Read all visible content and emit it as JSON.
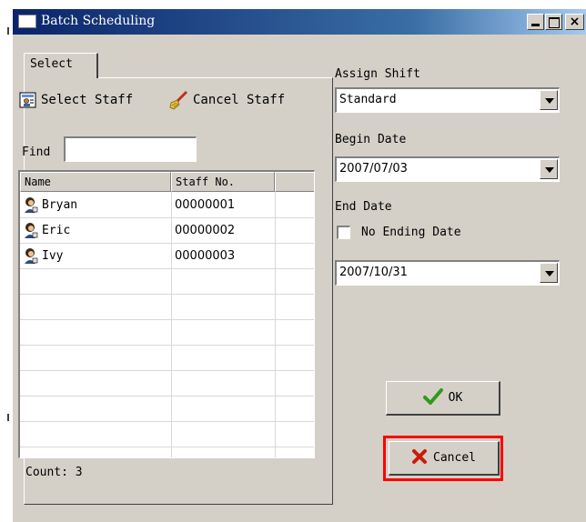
{
  "window": {
    "title": "Batch Scheduling",
    "close_glyph": "×"
  },
  "tab": {
    "label": "Select"
  },
  "toolbar": {
    "select_staff": "Select Staff",
    "cancel_staff": "Cancel Staff"
  },
  "find": {
    "label": "Find",
    "value": ""
  },
  "list": {
    "columns": [
      "Name",
      "Staff No.",
      ""
    ],
    "rows": [
      {
        "name": "Bryan",
        "staff_no": "00000001"
      },
      {
        "name": "Eric",
        "staff_no": "00000002"
      },
      {
        "name": "Ivy",
        "staff_no": "00000003"
      }
    ]
  },
  "count": {
    "label": "Count: 3"
  },
  "assign_shift": {
    "label": "Assign Shift",
    "value": "Standard"
  },
  "begin_date": {
    "label": "Begin Date",
    "value": "2007/07/03"
  },
  "end_date": {
    "label": "End Date",
    "no_ending_label": "No Ending Date",
    "no_ending_checked": false,
    "value": "2007/10/31"
  },
  "buttons": {
    "ok": "OK",
    "cancel": "Cancel"
  },
  "colors": {
    "titlebar_start": "#0a246a",
    "titlebar_end": "#a6caf0",
    "highlight": "#ff0000",
    "ok_check": "#2e9a1a",
    "cancel_x": "#cc1a0a"
  },
  "icons": {
    "select_staff": "staff-card-icon",
    "cancel_staff": "broom-icon",
    "person": "person-icon",
    "ok": "checkmark-icon",
    "cancel": "x-icon"
  }
}
